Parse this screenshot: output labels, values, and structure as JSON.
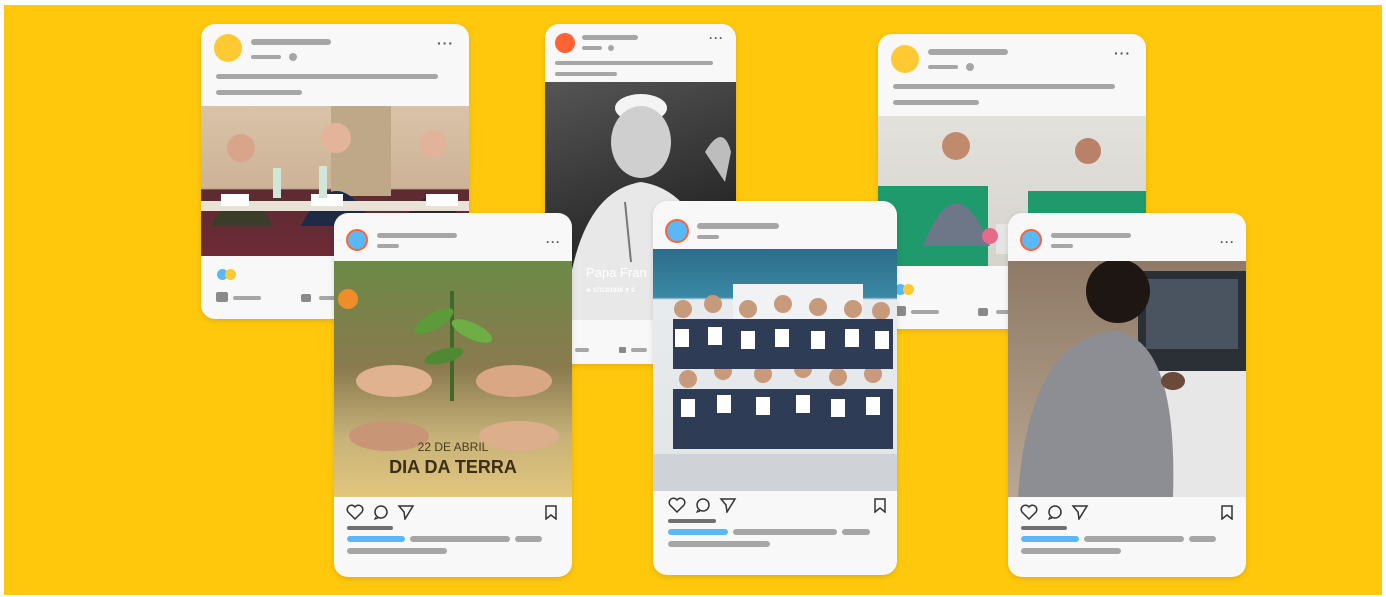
{
  "colors": {
    "background": "#ffc80c",
    "card": "#f8f8f8",
    "placeholder_bar": "#a6a6a6",
    "accent_blue": "#5bb8f6",
    "avatar_yellow": "#ffc933",
    "avatar_orange": "#ff6333"
  },
  "posts": [
    {
      "id": "panel-post",
      "style": "facebook",
      "image": "three-men-at-conference-table"
    },
    {
      "id": "earth-day-post",
      "style": "instagram",
      "image": "hands-planting-seedling",
      "caption_date": "22 DE ABRIL",
      "caption_title": "DIA DA TERRA"
    },
    {
      "id": "pope-post",
      "style": "facebook",
      "image": "pope-francis-portrait",
      "caption_name": "Papa Fran",
      "caption_dates": "★ 17/12/1936   ✝ 2"
    },
    {
      "id": "group-post",
      "style": "instagram",
      "image": "group-holding-certificates"
    },
    {
      "id": "interview-post",
      "style": "facebook",
      "image": "interview-on-green-sofas"
    },
    {
      "id": "laptop-post",
      "style": "instagram",
      "image": "girl-with-braids-at-laptop"
    }
  ],
  "icons": [
    "more-dots-icon",
    "heart-icon",
    "comment-icon",
    "send-icon",
    "bookmark-icon",
    "like-icon",
    "comment-bubble-icon"
  ]
}
